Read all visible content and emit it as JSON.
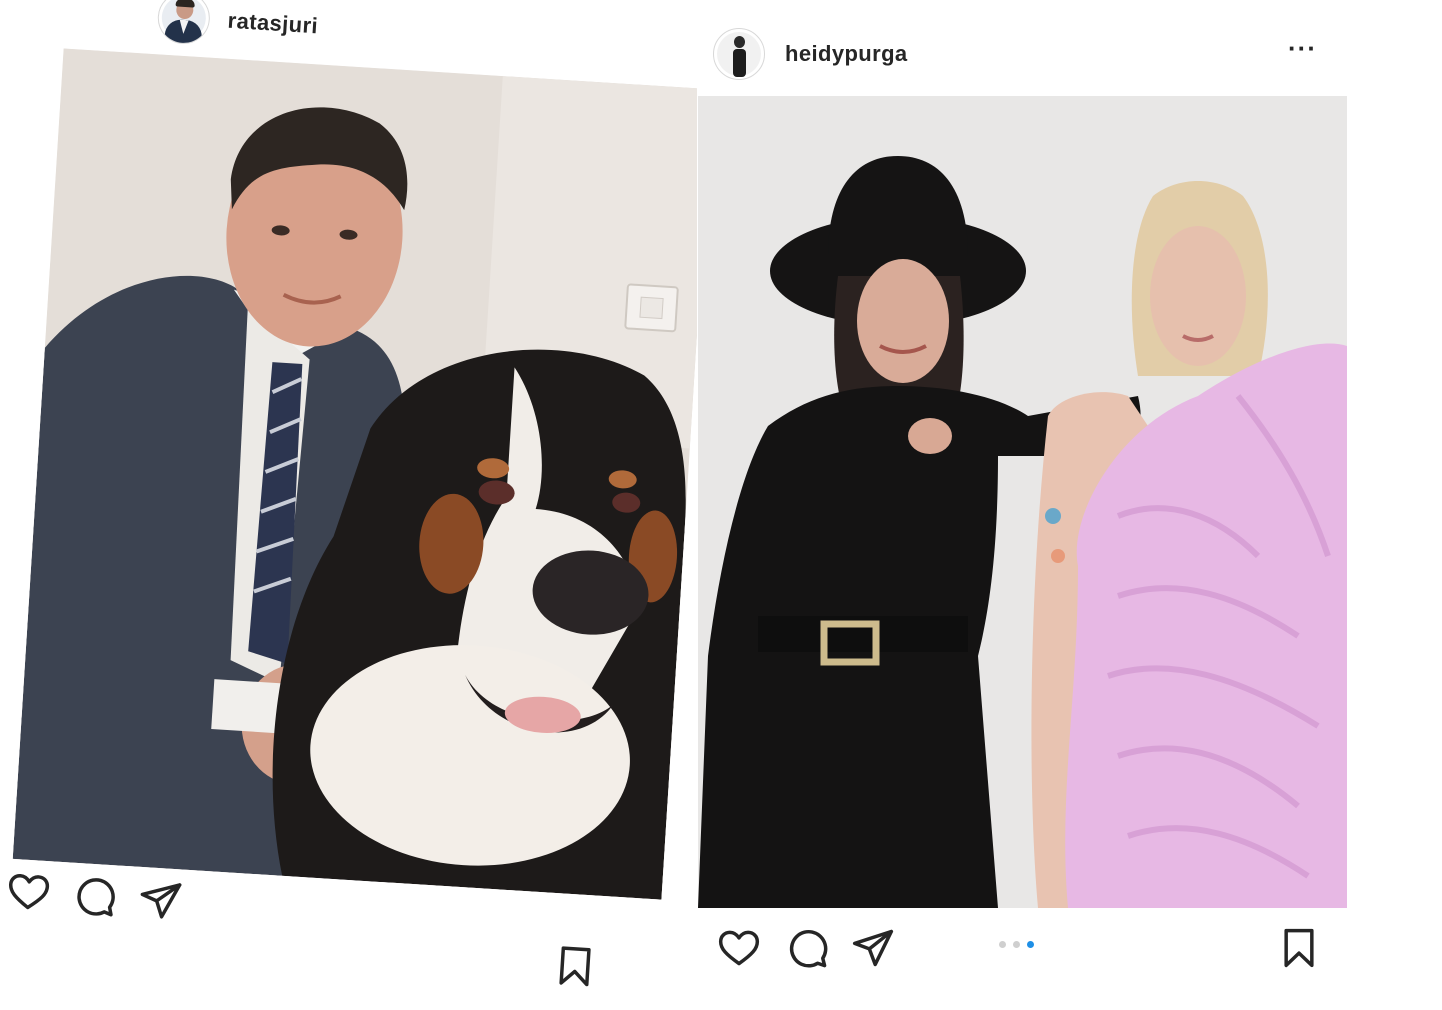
{
  "posts": [
    {
      "username": "ratasjuri",
      "photo_description": "Selfie of man in suit with Bernese mountain dog",
      "icons": [
        "heart-icon",
        "comment-icon",
        "share-icon",
        "bookmark-icon"
      ]
    },
    {
      "username": "heidypurga",
      "more_label": "···",
      "photo_description": "Two women posing, one in black hat and outfit, one in pink ruffled dress",
      "carousel": {
        "count": 3,
        "active_index": 2
      },
      "icons": [
        "heart-icon",
        "comment-icon",
        "share-icon",
        "bookmark-icon"
      ]
    }
  ],
  "colors": {
    "icon_stroke": "#262626",
    "carousel_active": "#1e8fe6",
    "carousel_inactive": "#cfcfcf",
    "dress_pink": "#e7b8e4"
  }
}
